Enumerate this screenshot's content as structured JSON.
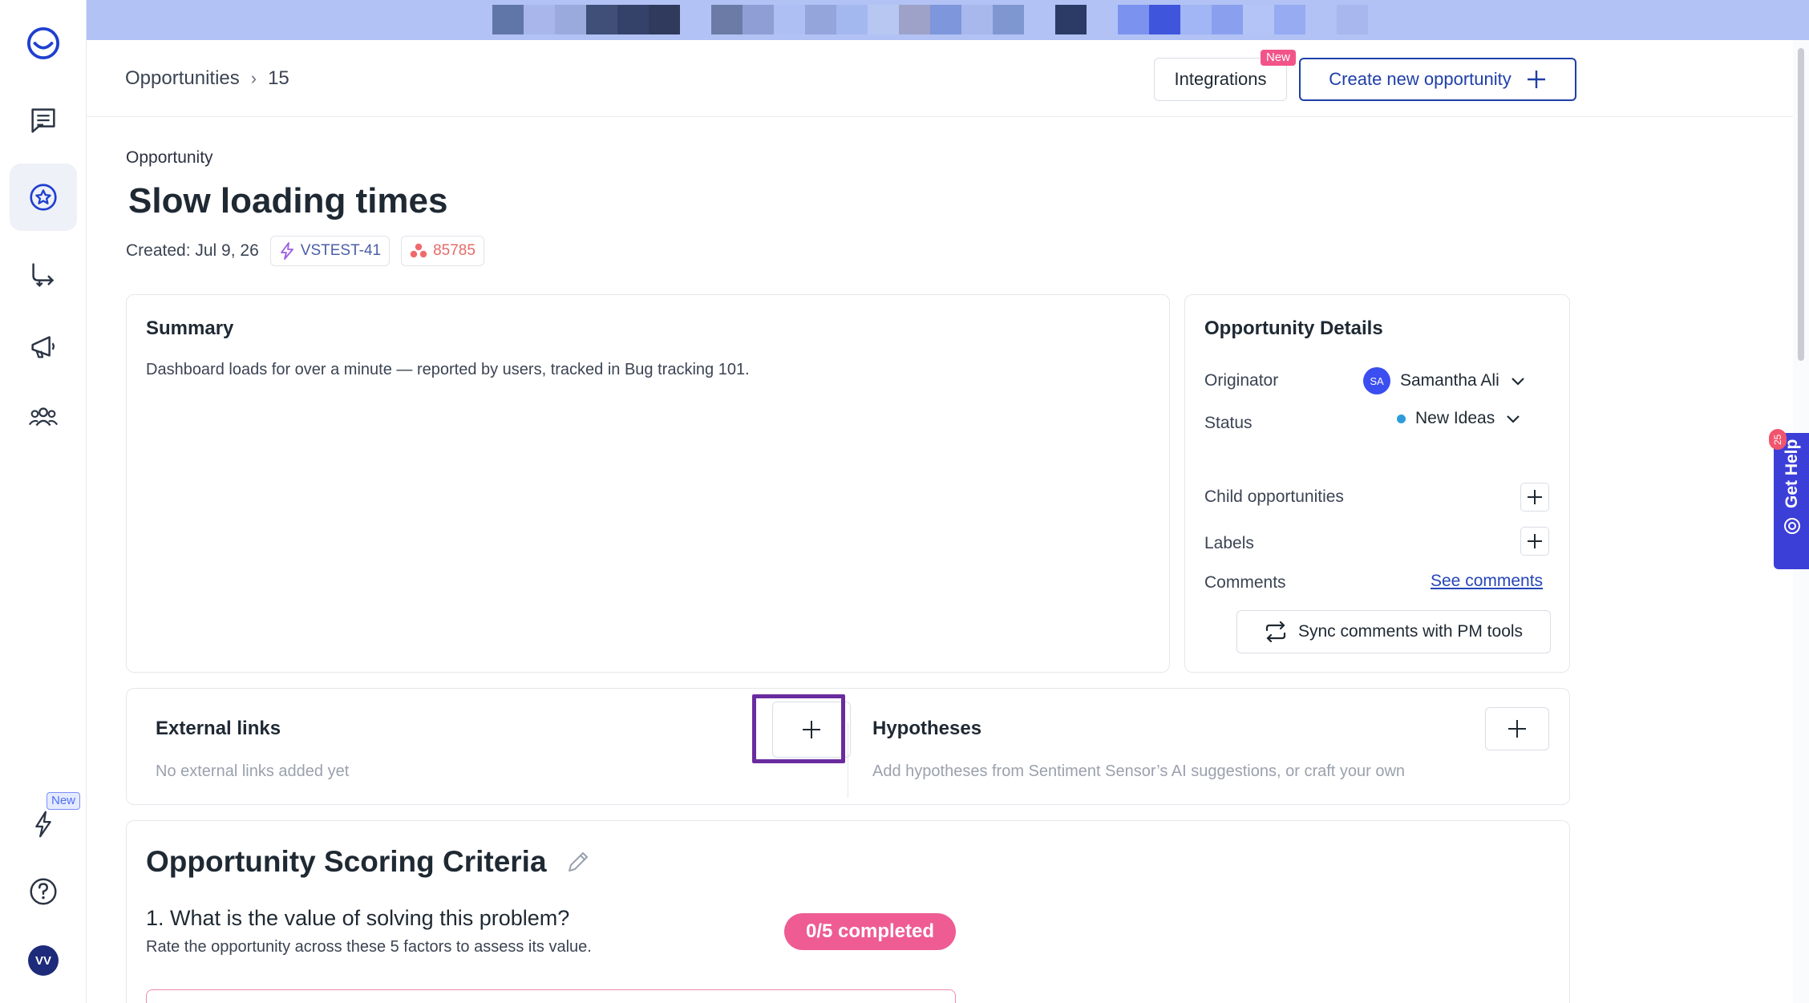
{
  "sidebar": {
    "items": [
      {
        "icon": "app-logo-icon"
      },
      {
        "icon": "messages-icon"
      },
      {
        "icon": "opportunities-star-icon",
        "active": true
      },
      {
        "icon": "routing-icon"
      },
      {
        "icon": "megaphone-icon"
      },
      {
        "icon": "team-icon"
      },
      {
        "icon": "lightning-icon"
      },
      {
        "icon": "help-icon"
      }
    ],
    "new_badge": "New",
    "user_initials": "VV"
  },
  "header": {
    "breadcrumb_root": "Opportunities",
    "breadcrumb_separator": "›",
    "breadcrumb_current": "15",
    "integrations_label": "Integrations",
    "integrations_badge": "New",
    "create_label": "Create new opportunity"
  },
  "opportunity": {
    "eyebrow": "Opportunity",
    "title": "Slow loading times",
    "created": "Created: Jul 9, 26",
    "issue_key": "VSTEST-41",
    "external_id": "85785"
  },
  "summary": {
    "title": "Summary",
    "text": "Dashboard loads for over a minute — reported by users, tracked in Bug tracking 101."
  },
  "details": {
    "title": "Opportunity Details",
    "originator_label": "Originator",
    "originator_initials": "SA",
    "originator_name": "Samantha Ali",
    "status_label": "Status",
    "status_value": "New Ideas",
    "status_color": "#2d9cdb",
    "child_label": "Child opportunities",
    "labels_label": "Labels",
    "comments_label": "Comments",
    "see_comments": "See comments",
    "sync_label": "Sync comments with PM tools"
  },
  "external_links": {
    "title": "External links",
    "empty": "No external links added yet"
  },
  "hypotheses": {
    "title": "Hypotheses",
    "empty": "Add hypotheses from Sentiment Sensor’s AI suggestions, or craft your own"
  },
  "scoring": {
    "title": "Opportunity Scoring Criteria",
    "question": "1. What is the value of solving this problem?",
    "subtitle": "Rate the opportunity across these 5 factors to assess its value.",
    "progress": "0/5 completed",
    "progress_color": "#ee5c93"
  },
  "get_help": {
    "label": "Get Help",
    "badge": "25"
  },
  "colors": {
    "brand": "#1f3fa7",
    "accent_pink": "#f2548a",
    "highlight": "#6a2b9f"
  }
}
